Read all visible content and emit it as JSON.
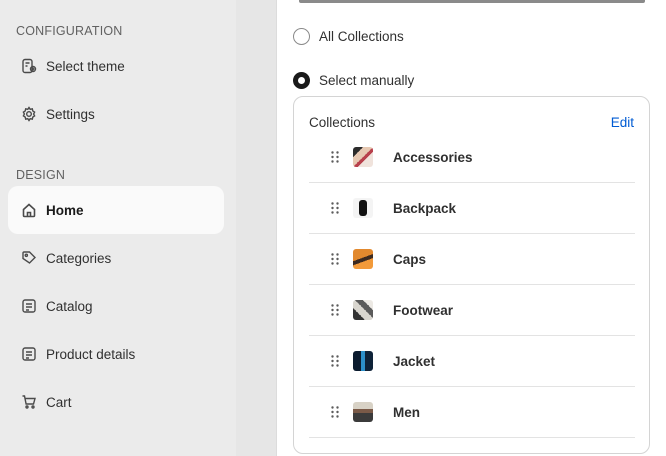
{
  "sidebar": {
    "sections": [
      {
        "title": "CONFIGURATION"
      },
      {
        "title": "DESIGN"
      }
    ],
    "items": [
      {
        "label": "Select theme",
        "icon": "theme-icon"
      },
      {
        "label": "Settings",
        "icon": "gear-icon"
      },
      {
        "label": "Home",
        "icon": "home-icon",
        "active": true
      },
      {
        "label": "Categories",
        "icon": "tag-icon"
      },
      {
        "label": "Catalog",
        "icon": "catalog-icon"
      },
      {
        "label": "Product details",
        "icon": "product-details-icon"
      },
      {
        "label": "Cart",
        "icon": "cart-icon"
      }
    ]
  },
  "panel": {
    "options": [
      {
        "label": "All Collections",
        "checked": false
      },
      {
        "label": "Select manually",
        "checked": true
      }
    ],
    "collections_card": {
      "title": "Collections",
      "edit_label": "Edit",
      "items": [
        {
          "label": "Accessories"
        },
        {
          "label": "Backpack"
        },
        {
          "label": "Caps"
        },
        {
          "label": "Footwear"
        },
        {
          "label": "Jacket"
        },
        {
          "label": "Men"
        }
      ]
    }
  },
  "colors": {
    "sidebar_bg": "#ebebeb",
    "active_item_bg": "#fafafa",
    "link": "#005bd3"
  }
}
